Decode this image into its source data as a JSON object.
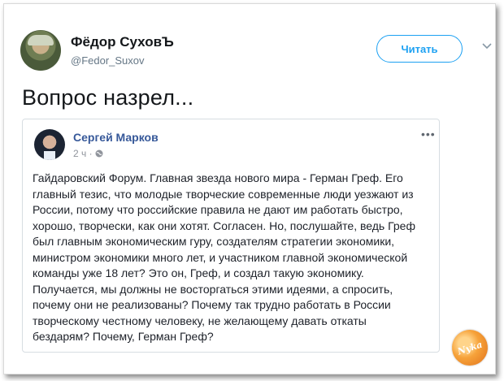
{
  "tweet": {
    "author_name": "Фёдор СуховЪ",
    "author_handle": "@Fedor_Suxov",
    "follow_label": "Читать",
    "text": "Вопрос назрел..."
  },
  "quoted_post": {
    "author_name": "Сергей Марков",
    "time": "2 ч ·",
    "more_label": "•••",
    "lines": [
      "Гайдаровский Форум. Главная звезда нового мира - Герман Греф. Его",
      "главный тезис, что молодые творческие современные люди уезжают из",
      "России, потому что российские правила не дают им работать быстро,",
      "хорошо, творчески, как они хотят. Согласен. Но, послушайте, ведь Греф",
      "был главным экономическим гуру, создателям стратегии экономики,",
      "министром экономики много лет, и участником главной экономической",
      "команды уже 18 лет? Это он, Греф, и создал такую экономику.",
      "Получается, мы должны не восторгаться этими идеями, а спросить,",
      "почему они не реализованы? Почему так трудно работать в России",
      "творческому честному человеку, не желающему давать откаты",
      "бездарям? Почему, Герман Греф?"
    ]
  },
  "watermark": {
    "text": "Nyka"
  },
  "colors": {
    "accent": "#1da1f2",
    "quote_author": "#365899",
    "text": "#14171a",
    "muted": "#657786"
  },
  "icons": [
    "avatar",
    "chevron-down-icon",
    "globe-icon",
    "more-icon",
    "watermark-logo"
  ]
}
